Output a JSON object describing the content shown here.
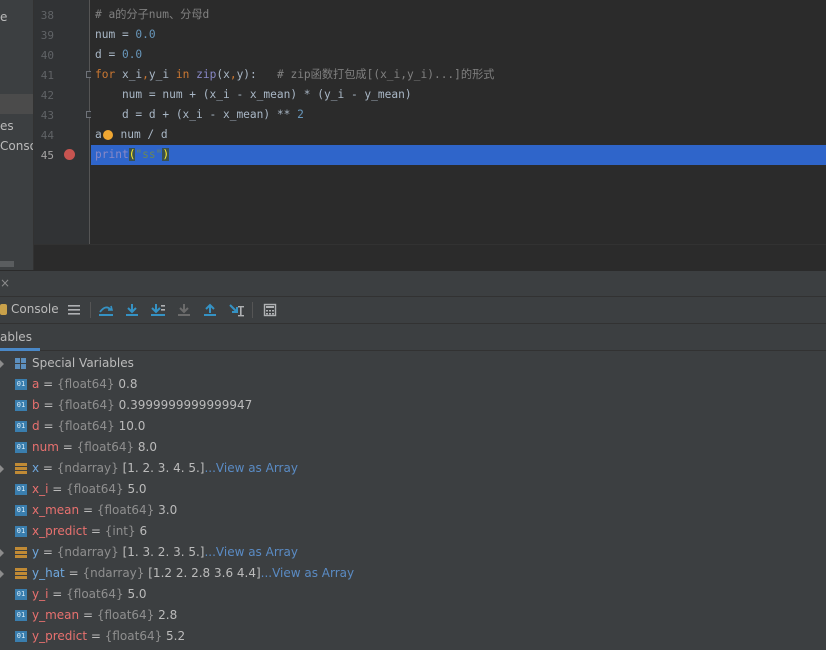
{
  "project": {
    "items": [
      {
        "label": "e"
      },
      {
        "label": "es"
      },
      {
        "label": "Conso"
      }
    ]
  },
  "editor": {
    "line_numbers": [
      "38",
      "39",
      "40",
      "41",
      "42",
      "43",
      "44",
      "45"
    ],
    "lines": [
      {
        "segments": [
          {
            "t": "# a的分子num、分母d",
            "c": "cmt"
          }
        ]
      },
      {
        "segments": [
          {
            "t": "num = ",
            "c": ""
          },
          {
            "t": "0.0",
            "c": "num"
          }
        ]
      },
      {
        "segments": [
          {
            "t": "d = ",
            "c": ""
          },
          {
            "t": "0.0",
            "c": "num"
          }
        ]
      },
      {
        "segments": [
          {
            "t": "for",
            "c": "kw"
          },
          {
            "t": " x_i",
            "c": ""
          },
          {
            "t": ",",
            "c": "kw"
          },
          {
            "t": "y_i ",
            "c": ""
          },
          {
            "t": "in",
            "c": "kw"
          },
          {
            "t": " ",
            "c": ""
          },
          {
            "t": "zip",
            "c": "bi"
          },
          {
            "t": "(x",
            "c": ""
          },
          {
            "t": ",",
            "c": "kw"
          },
          {
            "t": "y):   ",
            "c": ""
          },
          {
            "t": "# zip函数打包成[(x_i,y_i)...]的形式",
            "c": "cmt"
          }
        ]
      },
      {
        "segments": [
          {
            "t": "    num = num + (x_i - x_mean) * (y_i - y_mean)",
            "c": ""
          }
        ]
      },
      {
        "segments": [
          {
            "t": "    d = d + (x_i - x_mean) ** ",
            "c": ""
          },
          {
            "t": "2",
            "c": "num"
          }
        ]
      },
      {
        "segments": [
          {
            "t": "a",
            "c": ""
          },
          {
            "t": "BULB",
            "c": "bulb"
          },
          {
            "t": " num / d",
            "c": ""
          }
        ]
      },
      {
        "segments": [
          {
            "t": "print",
            "c": "bi"
          },
          {
            "t": "(",
            "c": "paren"
          },
          {
            "t": "\"ss\"",
            "c": "str"
          },
          {
            "t": ")",
            "c": "paren"
          }
        ]
      }
    ],
    "breakpoint_line": "45",
    "current_line": "45"
  },
  "debug": {
    "close_label": "×",
    "console_tab": "Console",
    "variables_tab": "ables",
    "toolbar_icons": [
      "show-execution-point-icon",
      "step-over-icon",
      "step-into-icon",
      "step-into-my-code-icon",
      "force-step-into-icon",
      "step-out-icon",
      "run-to-cursor-icon",
      "evaluate-expression-icon"
    ]
  },
  "variables": [
    {
      "kind": "special",
      "label": "Special Variables",
      "expandable": true
    },
    {
      "kind": "scalar",
      "name": "a",
      "type": "{float64}",
      "value": "0.8"
    },
    {
      "kind": "scalar",
      "name": "b",
      "type": "{float64}",
      "value": "0.3999999999999947"
    },
    {
      "kind": "scalar",
      "name": "d",
      "type": "{float64}",
      "value": "10.0"
    },
    {
      "kind": "scalar",
      "name": "num",
      "type": "{float64}",
      "value": "8.0"
    },
    {
      "kind": "array",
      "name": "x",
      "type": "{ndarray}",
      "value": "[1. 2. 3. 4. 5.]",
      "link": "...View as Array",
      "expandable": true
    },
    {
      "kind": "scalar",
      "name": "x_i",
      "type": "{float64}",
      "value": "5.0"
    },
    {
      "kind": "scalar",
      "name": "x_mean",
      "type": "{float64}",
      "value": "3.0"
    },
    {
      "kind": "scalar",
      "name": "x_predict",
      "type": "{int}",
      "value": "6"
    },
    {
      "kind": "array",
      "name": "y",
      "type": "{ndarray}",
      "value": "[1. 3. 2. 3. 5.]",
      "link": "...View as Array",
      "expandable": true
    },
    {
      "kind": "array",
      "name": "y_hat",
      "type": "{ndarray}",
      "value": "[1.2 2.  2.8 3.6 4.4]",
      "link": "...View as Array",
      "expandable": true
    },
    {
      "kind": "scalar",
      "name": "y_i",
      "type": "{float64}",
      "value": "5.0"
    },
    {
      "kind": "scalar",
      "name": "y_mean",
      "type": "{float64}",
      "value": "2.8"
    },
    {
      "kind": "scalar",
      "name": "y_predict",
      "type": "{float64}",
      "value": "5.2"
    }
  ]
}
